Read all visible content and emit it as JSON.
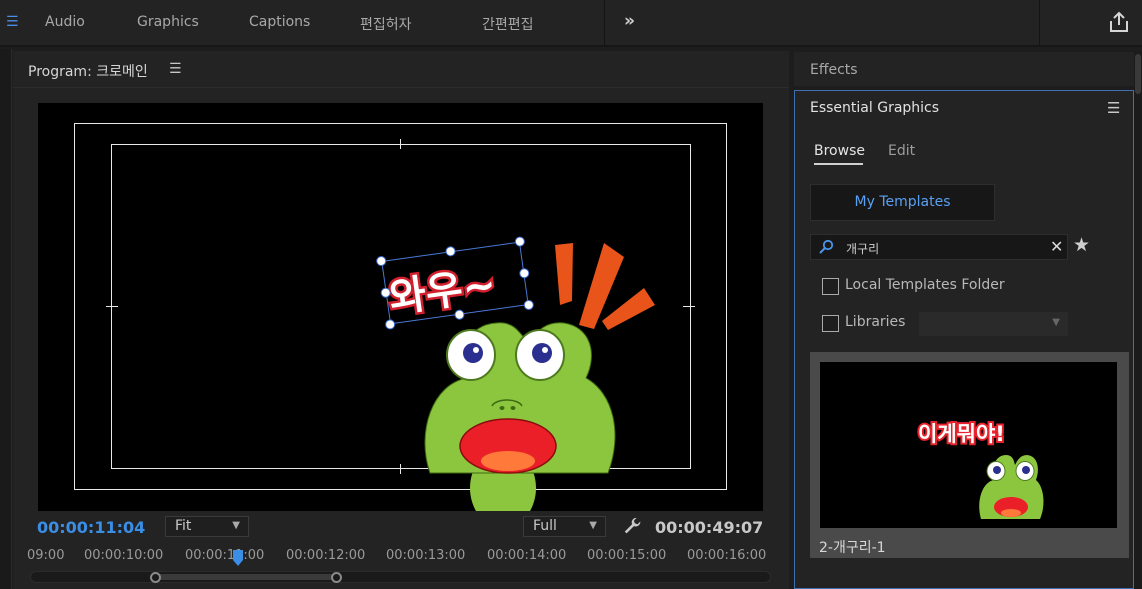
{
  "workspace": {
    "tabs": [
      "Audio",
      "Graphics",
      "Captions",
      "편집허자",
      "간편편집"
    ],
    "overflow": "»"
  },
  "program": {
    "title": "Program: 크로메인",
    "timecode_current": "00:00:11:04",
    "timecode_duration": "00:00:49:07",
    "zoom_select": "Fit",
    "resolution_select": "Full",
    "overlay_text": "와우~",
    "ruler_labels": [
      "09:00",
      "00:00:10:00",
      "00:00:11:00",
      "00:00:12:00",
      "00:00:13:00",
      "00:00:14:00",
      "00:00:15:00",
      "00:00:16:00"
    ]
  },
  "effects_panel": {
    "title": "Effects"
  },
  "essential_graphics": {
    "title": "Essential Graphics",
    "tabs": {
      "browse": "Browse",
      "edit": "Edit"
    },
    "my_templates_label": "My Templates",
    "search_value": "개구리",
    "local_templates_label": "Local Templates Folder",
    "libraries_label": "Libraries",
    "template_item": {
      "name": "2-개구리-1",
      "preview_text": "이게뭐야!"
    }
  },
  "colors": {
    "accent_blue": "#3a8ee6",
    "frog_green": "#8cc63f",
    "text_red": "#e8232d",
    "burst_orange": "#e8541a"
  },
  "icons": [
    "workspace-menu-icon",
    "share-icon",
    "wrench-icon",
    "search-icon",
    "clear-icon",
    "star-icon",
    "panel-menu-icon",
    "chevron-down-icon"
  ]
}
